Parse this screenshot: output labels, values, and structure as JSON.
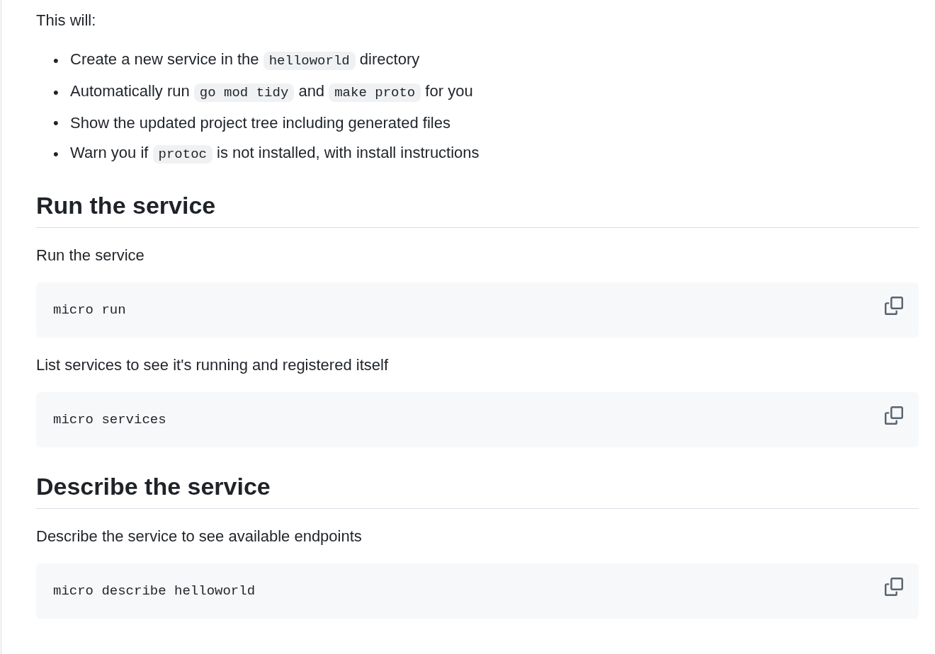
{
  "blocks": [
    {
      "kind": "paragraph",
      "text": "This will:"
    },
    {
      "kind": "list",
      "items": [
        {
          "marker": "•",
          "parts": [
            {
              "kind": "text",
              "text": "Create a new service in the "
            },
            {
              "kind": "code",
              "text": "helloworld"
            },
            {
              "kind": "text",
              "text": " directory"
            }
          ]
        },
        {
          "marker": "•",
          "parts": [
            {
              "kind": "text",
              "text": "Automatically run "
            },
            {
              "kind": "code",
              "text": "go mod tidy"
            },
            {
              "kind": "text",
              "text": " and "
            },
            {
              "kind": "code",
              "text": "make proto"
            },
            {
              "kind": "text",
              "text": " for you"
            }
          ]
        },
        {
          "marker": "•",
          "parts": [
            {
              "kind": "text",
              "text": "Show the updated project tree including generated files"
            }
          ]
        },
        {
          "marker": "•",
          "parts": [
            {
              "kind": "text",
              "text": "Warn you if "
            },
            {
              "kind": "code",
              "text": "protoc"
            },
            {
              "kind": "text",
              "text": " is not installed, with install instructions"
            }
          ]
        }
      ]
    },
    {
      "kind": "heading",
      "text": "Run the service"
    },
    {
      "kind": "paragraph",
      "text": "Run the service"
    },
    {
      "kind": "code",
      "text": "micro run"
    },
    {
      "kind": "paragraph",
      "text": "List services to see it's running and registered itself"
    },
    {
      "kind": "code",
      "text": "micro services"
    },
    {
      "kind": "heading",
      "text": "Describe the service"
    },
    {
      "kind": "paragraph",
      "text": "Describe the service to see available endpoints"
    },
    {
      "kind": "code",
      "text": "micro describe helloworld"
    }
  ]
}
